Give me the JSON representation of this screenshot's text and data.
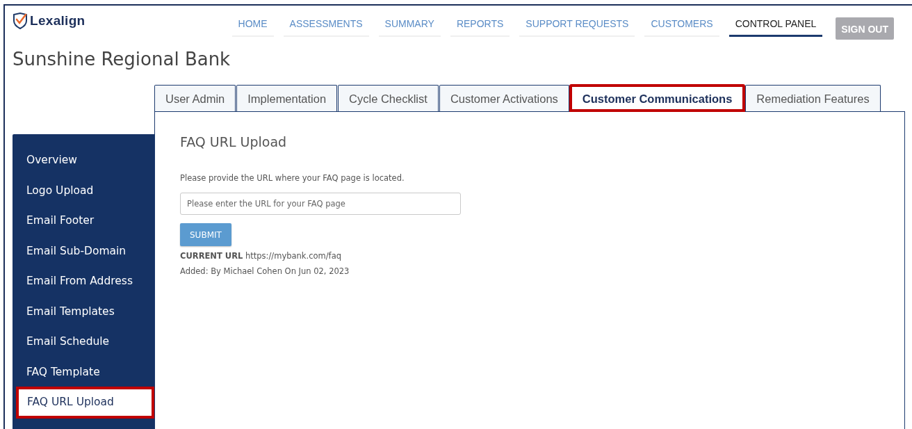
{
  "header": {
    "logo_text": "Lexalign",
    "nav": [
      {
        "label": "HOME",
        "selected": false
      },
      {
        "label": "ASSESSMENTS",
        "selected": false
      },
      {
        "label": "SUMMARY",
        "selected": false
      },
      {
        "label": "REPORTS",
        "selected": false
      },
      {
        "label": "SUPPORT REQUESTS",
        "selected": false
      },
      {
        "label": "CUSTOMERS",
        "selected": false
      },
      {
        "label": "CONTROL PANEL",
        "selected": true
      }
    ],
    "sign_out": {
      "label": "SIGN OUT",
      "disabled": true
    }
  },
  "page_title": "Sunshine Regional Bank",
  "tabs": [
    {
      "label": "User Admin",
      "selected": false,
      "highlighted": false
    },
    {
      "label": "Implementation",
      "selected": false,
      "highlighted": false
    },
    {
      "label": "Cycle Checklist",
      "selected": false,
      "highlighted": false
    },
    {
      "label": "Customer Activations",
      "selected": false,
      "highlighted": false
    },
    {
      "label": "Customer Communications",
      "selected": true,
      "highlighted": true
    },
    {
      "label": "Remediation Features",
      "selected": false,
      "highlighted": false
    }
  ],
  "sidebar": {
    "items": [
      {
        "label": "Overview",
        "selected": false,
        "highlighted": false
      },
      {
        "label": "Logo Upload",
        "selected": false,
        "highlighted": false
      },
      {
        "label": "Email Footer",
        "selected": false,
        "highlighted": false
      },
      {
        "label": "Email Sub-Domain",
        "selected": false,
        "highlighted": false
      },
      {
        "label": "Email From Address",
        "selected": false,
        "highlighted": false
      },
      {
        "label": "Email Templates",
        "selected": false,
        "highlighted": false
      },
      {
        "label": "Email Schedule",
        "selected": false,
        "highlighted": false
      },
      {
        "label": "FAQ Template",
        "selected": false,
        "highlighted": false
      },
      {
        "label": "FAQ URL Upload",
        "selected": true,
        "highlighted": true
      }
    ]
  },
  "content": {
    "heading": "FAQ URL Upload",
    "instruction": "Please provide the URL where your FAQ page is located.",
    "url_field": {
      "placeholder": "Please enter the URL for your FAQ page"
    },
    "submit_button": "SUBMIT",
    "current_url": "**CURRENT URL** https://mybank.com/faq",
    "added_note": "Added: By Michael Cohen On Jun 02, 2023"
  }
}
